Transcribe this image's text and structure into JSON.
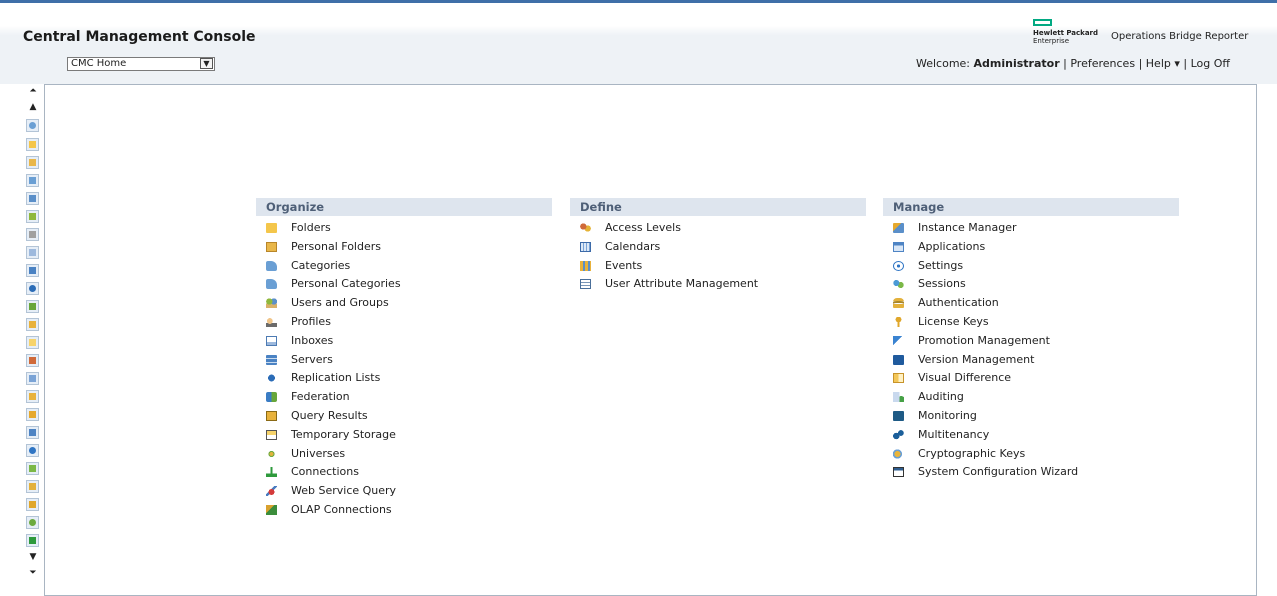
{
  "header": {
    "app_title": "Central Management Console",
    "brand_line1": "Hewlett Packard",
    "brand_line2": "Enterprise",
    "product_name": "Operations Bridge Reporter"
  },
  "nav": {
    "selected": "CMC Home"
  },
  "userbar": {
    "welcome": "Welcome:",
    "user": "Administrator",
    "sep1": "|",
    "preferences": "Preferences",
    "sep2": "|",
    "help": "Help ▾",
    "sep3": "|",
    "logoff": "Log Off"
  },
  "organize": {
    "title": "Organize",
    "items": [
      "Folders",
      "Personal Folders",
      "Categories",
      "Personal Categories",
      "Users and Groups",
      "Profiles",
      "Inboxes",
      "Servers",
      "Replication Lists",
      "Federation",
      "Query Results",
      "Temporary Storage",
      "Universes",
      "Connections",
      "Web Service Query",
      "OLAP Connections"
    ]
  },
  "define": {
    "title": "Define",
    "items": [
      "Access Levels",
      "Calendars",
      "Events",
      "User Attribute Management"
    ]
  },
  "manage": {
    "title": "Manage",
    "items": [
      "Instance Manager",
      "Applications",
      "Settings",
      "Sessions",
      "Authentication",
      "License Keys",
      "Promotion Management",
      "Version Management",
      "Visual Difference",
      "Auditing",
      "Monitoring",
      "Multitenancy",
      "Cryptographic Keys",
      "System Configuration Wizard"
    ]
  },
  "rail": {
    "top_first": "⏶",
    "up": "▲",
    "down": "▼",
    "bottom_last": "⏷"
  },
  "colors": {
    "accent": "#3f6fa8",
    "section_header_bg": "#dee5ee",
    "section_header_text": "#4e5f77",
    "hpe_green": "#01a982"
  }
}
